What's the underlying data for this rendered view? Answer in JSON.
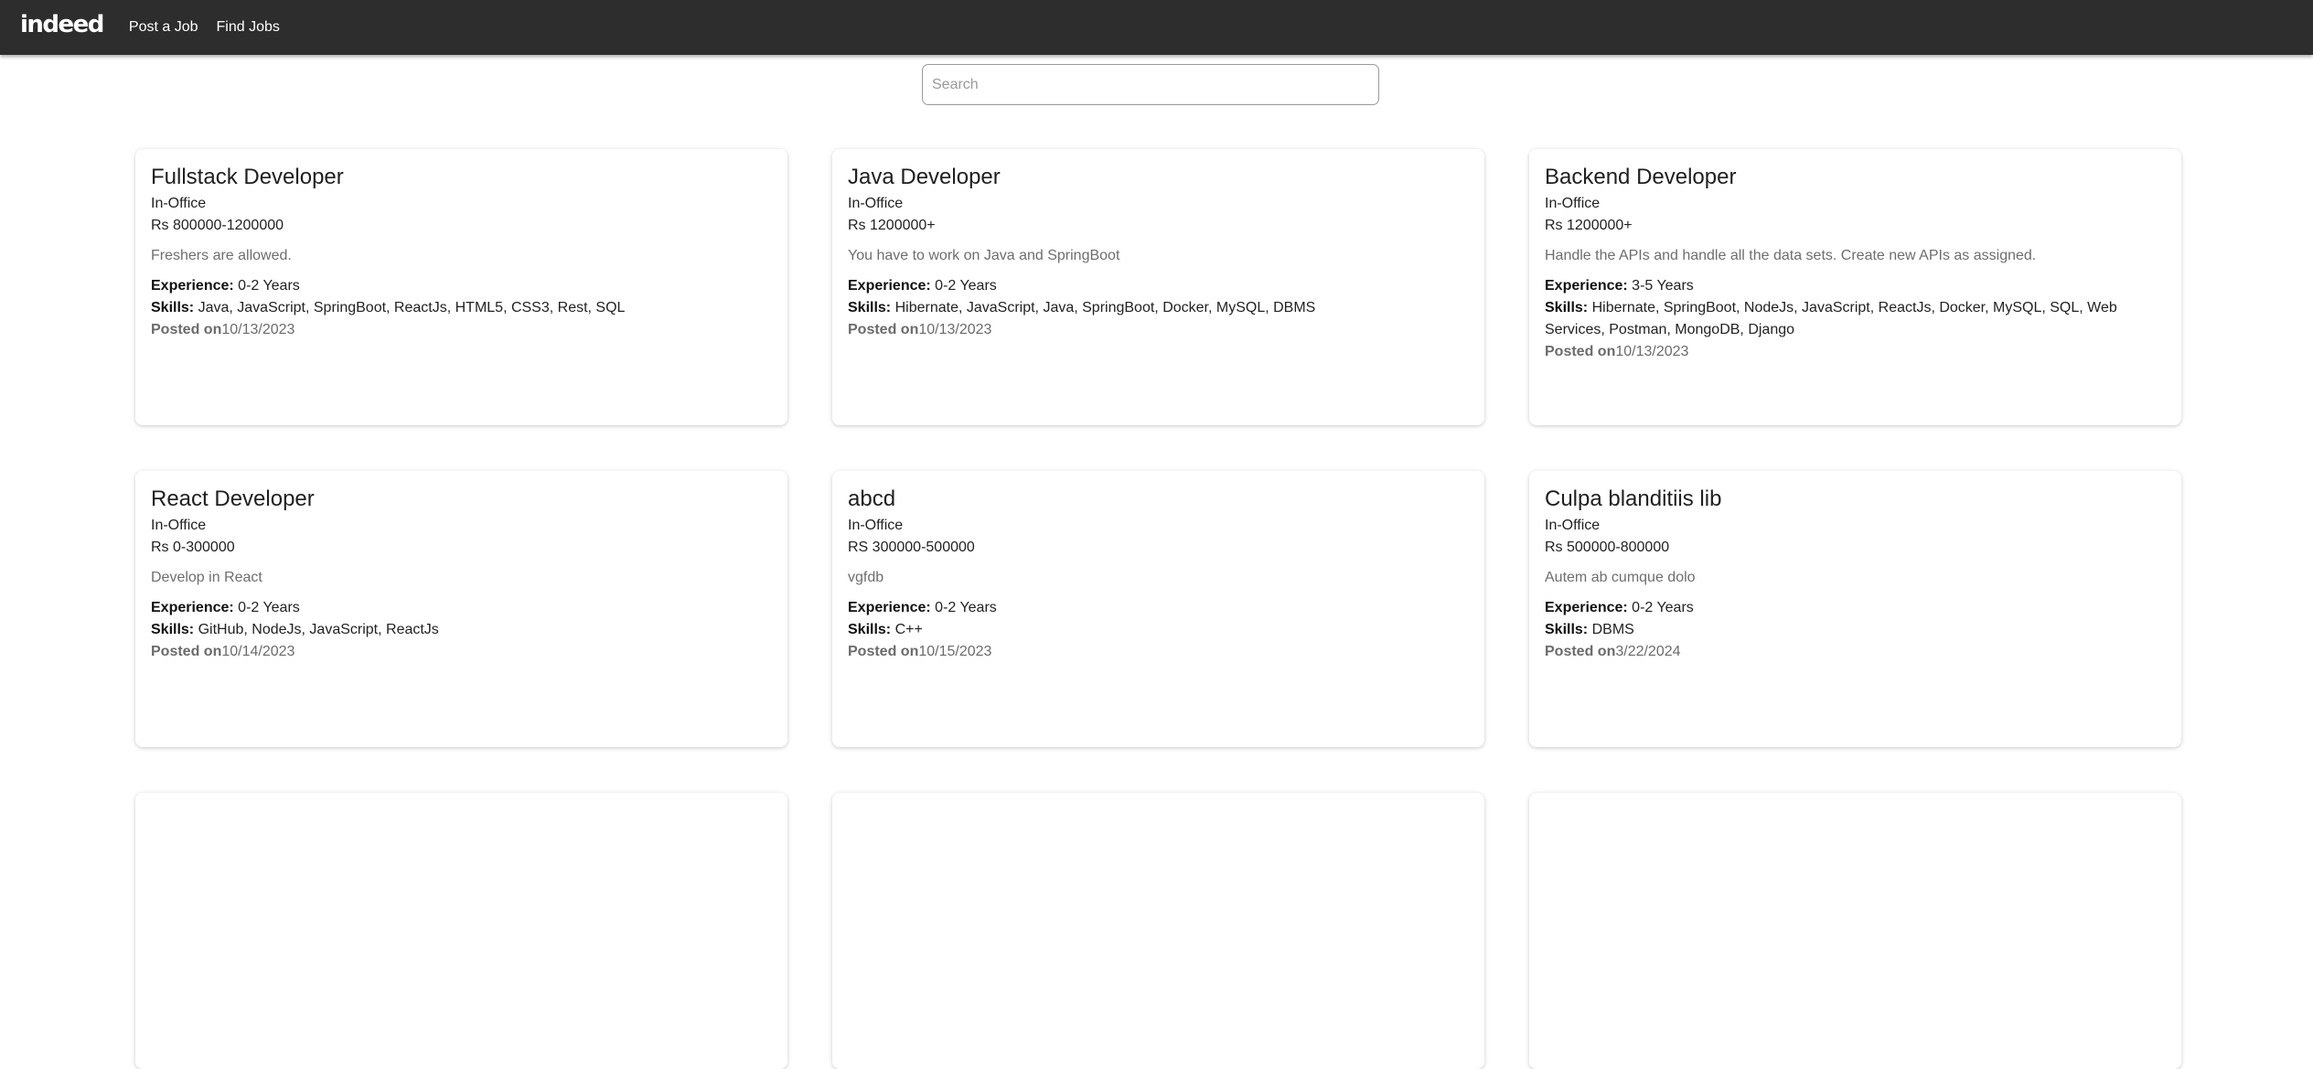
{
  "navbar": {
    "logo": "indeed",
    "links": [
      "Post a Job",
      "Find Jobs"
    ]
  },
  "search": {
    "placeholder": "Search",
    "value": ""
  },
  "labels": {
    "experience": "Experience:",
    "skills": "Skills:",
    "posted": "Posted on"
  },
  "jobs": [
    {
      "title": "Fullstack Developer",
      "mode": "In-Office",
      "salary": "Rs 800000-1200000",
      "description": "Freshers are allowed.",
      "experience": "0-2 Years",
      "skills": "Java, JavaScript, SpringBoot, ReactJs, HTML5, CSS3, Rest, SQL",
      "posted": "10/13/2023"
    },
    {
      "title": "Java Developer",
      "mode": "In-Office",
      "salary": "Rs 1200000+",
      "description": "You have to work on Java and SpringBoot",
      "experience": "0-2 Years",
      "skills": "Hibernate, JavaScript, Java, SpringBoot, Docker, MySQL, DBMS",
      "posted": "10/13/2023"
    },
    {
      "title": "Backend Developer",
      "mode": "In-Office",
      "salary": "Rs 1200000+",
      "description": "Handle the APIs and handle all the data sets. Create new APIs as assigned.",
      "experience": "3-5 Years",
      "skills": "Hibernate, SpringBoot, NodeJs, JavaScript, ReactJs, Docker, MySQL, SQL, Web Services, Postman, MongoDB, Django",
      "posted": "10/13/2023"
    },
    {
      "title": "React Developer",
      "mode": "In-Office",
      "salary": "Rs 0-300000",
      "description": "Develop in React",
      "experience": "0-2 Years",
      "skills": "GitHub, NodeJs, JavaScript, ReactJs",
      "posted": "10/14/2023"
    },
    {
      "title": "abcd",
      "mode": "In-Office",
      "salary": "RS 300000-500000",
      "description": "vgfdb",
      "experience": "0-2 Years",
      "skills": "C++",
      "posted": "10/15/2023"
    },
    {
      "title": "Culpa blanditiis lib",
      "mode": "In-Office",
      "salary": "Rs 500000-800000",
      "description": "Autem ab cumque dolo",
      "experience": "0-2 Years",
      "skills": "DBMS",
      "posted": "3/22/2024"
    }
  ]
}
